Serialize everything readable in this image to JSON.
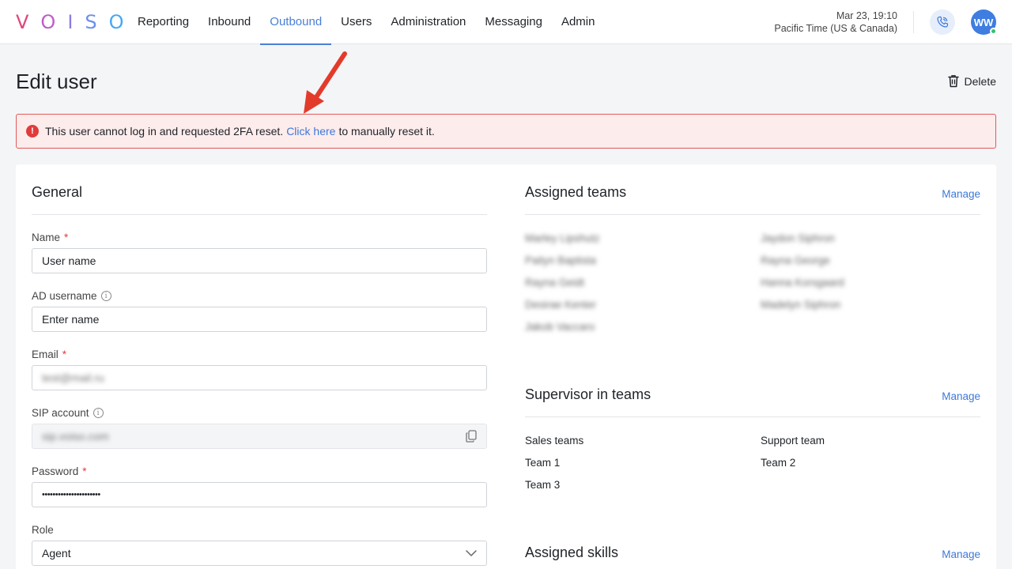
{
  "logo": {
    "text": [
      "V",
      "O",
      "I",
      "S",
      "O"
    ],
    "colors": [
      "#e0457b",
      "#c05bc9",
      "#8e7ae6",
      "#6b8ff0",
      "#46a8f5"
    ]
  },
  "nav": {
    "items": [
      {
        "label": "Reporting"
      },
      {
        "label": "Inbound"
      },
      {
        "label": "Outbound",
        "active": true
      },
      {
        "label": "Users"
      },
      {
        "label": "Administration"
      },
      {
        "label": "Messaging"
      },
      {
        "label": "Admin"
      }
    ]
  },
  "clock": {
    "datetime": "Mar 23, 19:10",
    "timezone": "Pacific Time (US & Canada)"
  },
  "user": {
    "initials": "WW",
    "status_color": "#35c26b"
  },
  "page": {
    "title": "Edit user",
    "delete_label": "Delete"
  },
  "alert": {
    "text_before": "This user cannot log in and requested 2FA reset.",
    "link": "Click here",
    "text_after": "to manually reset it."
  },
  "general": {
    "title": "General",
    "name": {
      "label": "Name",
      "required_mark": "*",
      "value": "User name"
    },
    "ad_username": {
      "label": "AD username",
      "value": "Enter name"
    },
    "email": {
      "label": "Email",
      "required_mark": "*",
      "value": "test@mail.ru"
    },
    "sip": {
      "label": "SIP account",
      "value": "sip.voiso.com"
    },
    "password": {
      "label": "Password",
      "required_mark": "*",
      "value": "••••••••••••••••••••••"
    },
    "role": {
      "label": "Role",
      "value": "Agent"
    }
  },
  "assigned_teams": {
    "title": "Assigned teams",
    "manage": "Manage",
    "left": [
      "Marley Lipshutz",
      "Paityn Baptista",
      "Rayna Geidt",
      "Desirae Kenter",
      "Jakob Vaccaro"
    ],
    "right": [
      "Jaydon Siphron",
      "Rayna George",
      "Hanna Korsgaard",
      "Madelyn Siphron"
    ]
  },
  "supervisor_teams": {
    "title": "Supervisor in teams",
    "manage": "Manage",
    "left": [
      "Sales teams",
      "Team 1",
      "Team 3"
    ],
    "right": [
      "Support team",
      "Team 2"
    ]
  },
  "assigned_skills": {
    "title": "Assigned skills",
    "manage": "Manage"
  }
}
